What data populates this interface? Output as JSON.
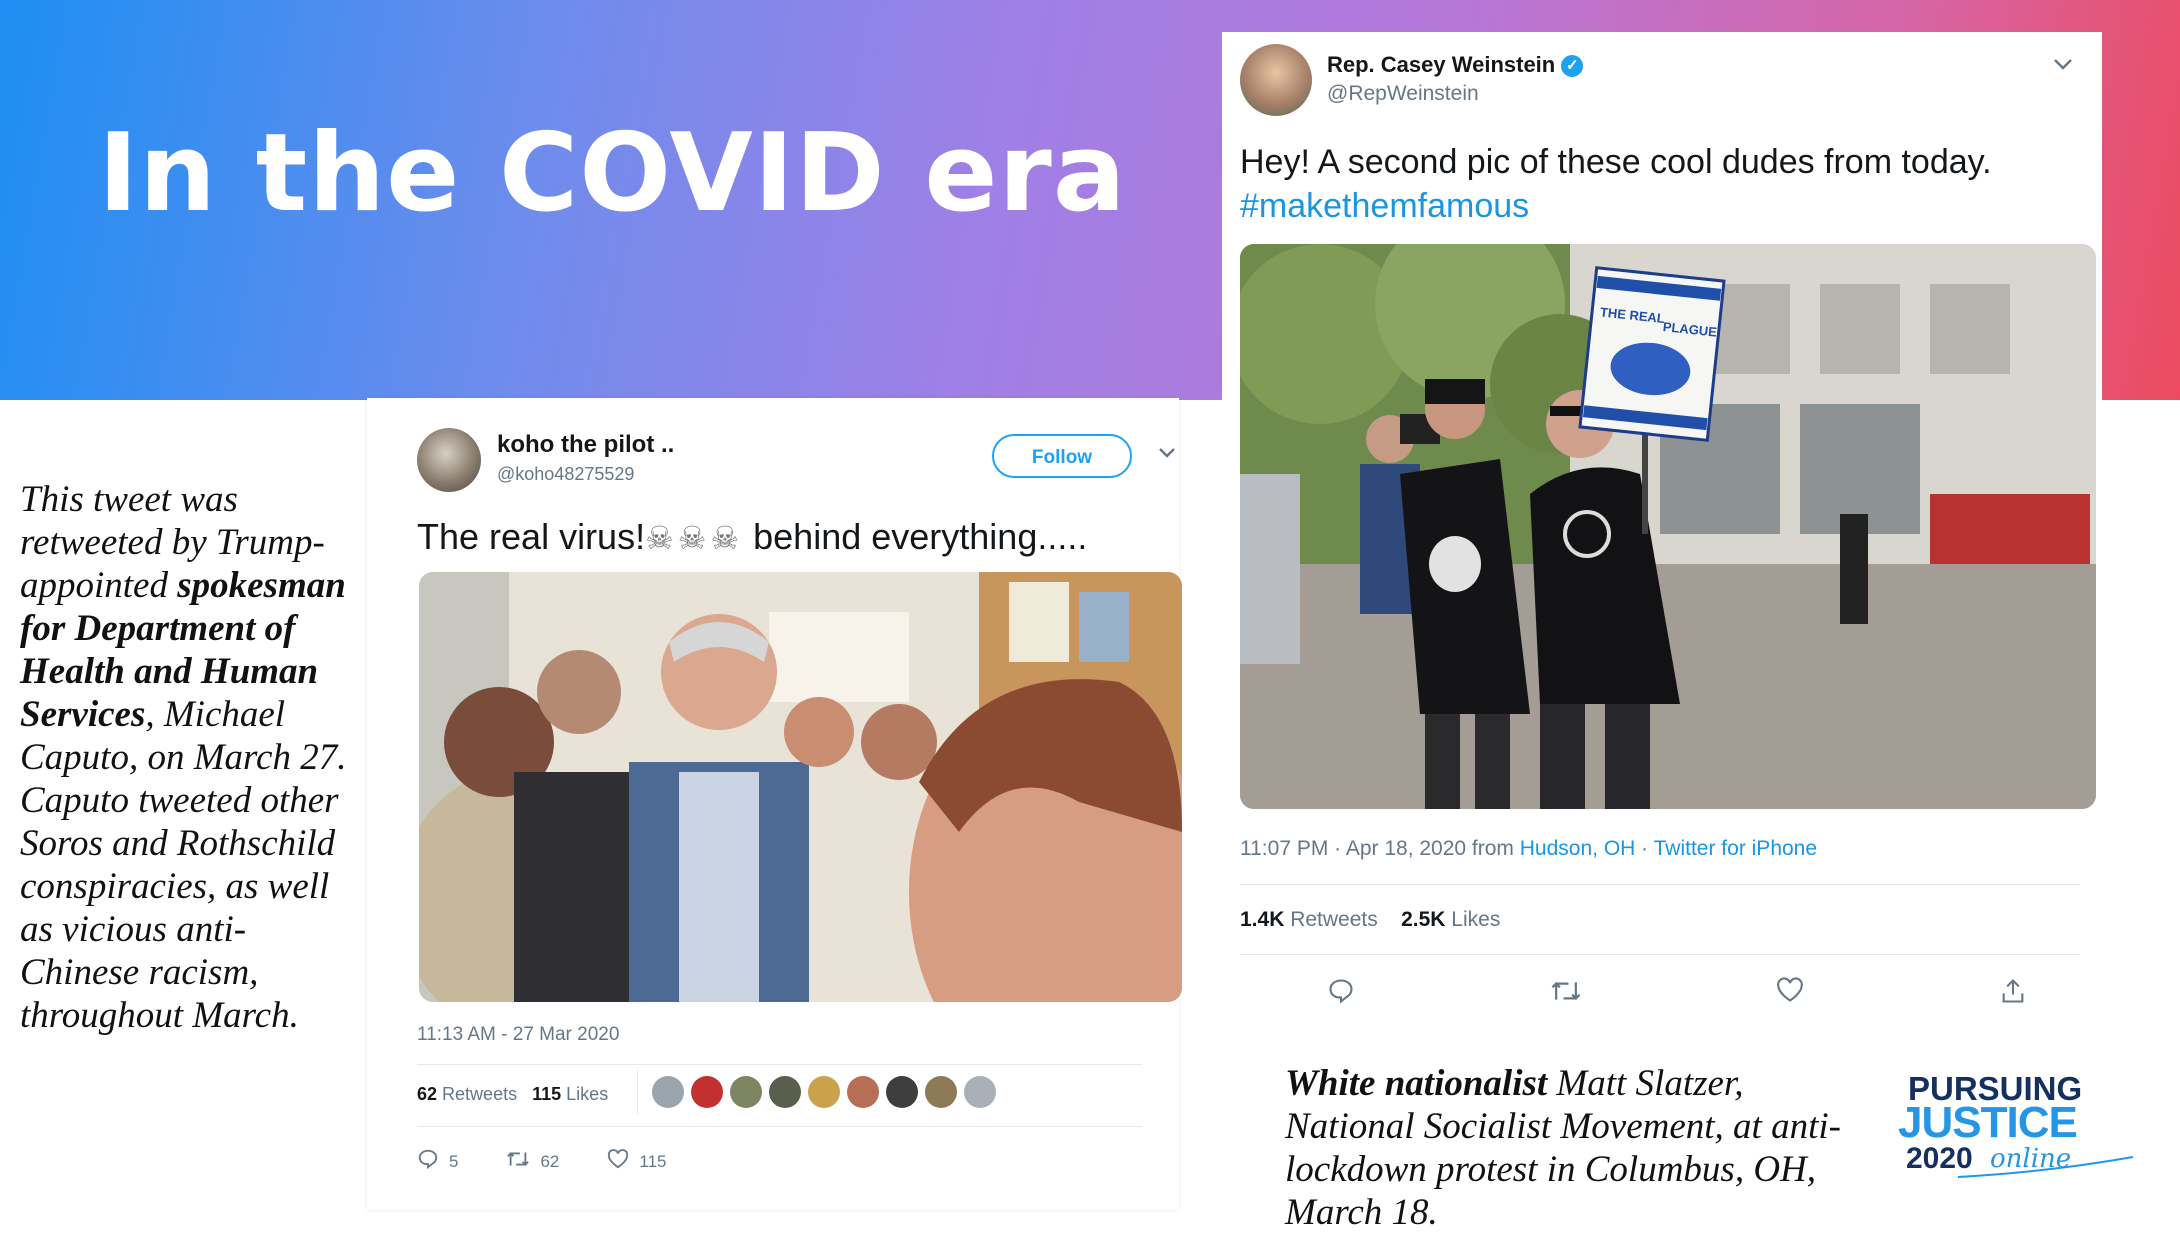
{
  "banner": {
    "title": "In the COVID era"
  },
  "caption_left": {
    "line_a": "This tweet was retweeted by Trump-appointed ",
    "bold": "spokesman for Department of Health and Human Services",
    "line_b": ", Michael Caputo, on March 27. Caputo tweeted other Soros and Rothschild conspiracies, as well as vicious anti-Chinese racism, throughout March."
  },
  "tweet1": {
    "name": "koho the pilot ..",
    "handle": "@koho48275529",
    "follow_label": "Follow",
    "text": "The real virus!",
    "skulls": "☠☠☠",
    "text_end": " behind everything.....",
    "timestamp": "11:13 AM - 27 Mar 2020",
    "retweets_count": "62",
    "retweets_label": "Retweets",
    "likes_count": "115",
    "likes_label": "Likes",
    "reply_count": "5",
    "retweet_action_count": "62",
    "like_action_count": "115",
    "liker_colors": [
      "#9aa4ad",
      "#c23030",
      "#7d8660",
      "#5a5e4c",
      "#c9a24b",
      "#b66f54",
      "#3e3e3e",
      "#8b7a55",
      "#a9b0b7"
    ]
  },
  "tweet2": {
    "name": "Rep. Casey Weinstein",
    "verified_icon": "✓",
    "handle": "@RepWeinstein",
    "text": "Hey! A second pic of these cool dudes from today.",
    "hashtag": "#makethemfamous",
    "sign_line1": "THE REAL",
    "sign_line2": "PLAGUE",
    "time": "11:07 PM · Apr 18, 2020 from ",
    "location": "Hudson, OH",
    "separator": " · ",
    "source": "Twitter for iPhone",
    "retweets_count": "1.4K",
    "retweets_label": "Retweets",
    "likes_count": "2.5K",
    "likes_label": "Likes"
  },
  "caption_right": {
    "bold": "White nationalist",
    "rest": " Matt Slatzer, National Socialist Movement, at anti-lockdown protest in Columbus, OH, March 18."
  },
  "logo": {
    "line1": "PURSUING",
    "line2": "JUSTICE",
    "line3": "2020",
    "line4": "online"
  },
  "icons": {
    "reply": "reply-icon",
    "retweet": "retweet-icon",
    "like": "heart-icon",
    "share": "share-icon",
    "chevron": "chevron-down-icon"
  }
}
